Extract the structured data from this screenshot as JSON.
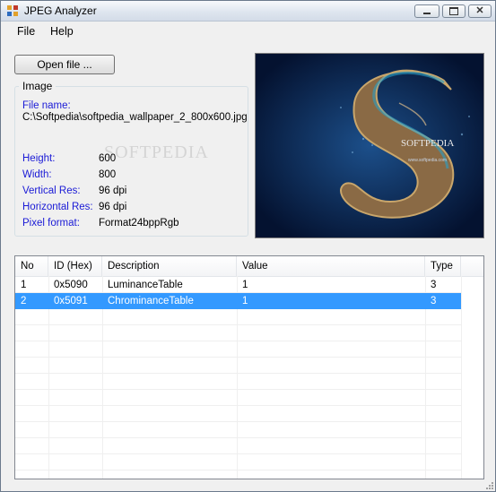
{
  "window": {
    "title": "JPEG Analyzer"
  },
  "menu": {
    "items": [
      "File",
      "Help"
    ]
  },
  "toolbar": {
    "open_label": "Open file ..."
  },
  "image_group": {
    "title": "Image",
    "file_name_label": "File name:",
    "file_name_value": "C:\\Softpedia\\softpedia_wallpaper_2_800x600.jpg",
    "height_label": "Height:",
    "height_value": "600",
    "width_label": "Width:",
    "width_value": "800",
    "vres_label": "Vertical Res:",
    "vres_value": "96 dpi",
    "hres_label": "Horizontal Res:",
    "hres_value": "96 dpi",
    "pixfmt_label": "Pixel format:",
    "pixfmt_value": "Format24bppRgb"
  },
  "preview": {
    "caption": "SOFTPEDIA",
    "url": "www.softpedia.com"
  },
  "table": {
    "columns": [
      "No",
      "ID (Hex)",
      "Description",
      "Value",
      "Type"
    ],
    "rows": [
      {
        "no": "1",
        "id": "0x5090",
        "description": "LuminanceTable",
        "value": "1",
        "type": "3"
      },
      {
        "no": "2",
        "id": "0x5091",
        "description": "ChrominanceTable",
        "value": "1",
        "type": "3"
      }
    ],
    "selected_row": 2
  },
  "colors": {
    "selection": "#3399ff",
    "label_blue": "#1a1ad6",
    "preview_bg": "#05163a"
  }
}
